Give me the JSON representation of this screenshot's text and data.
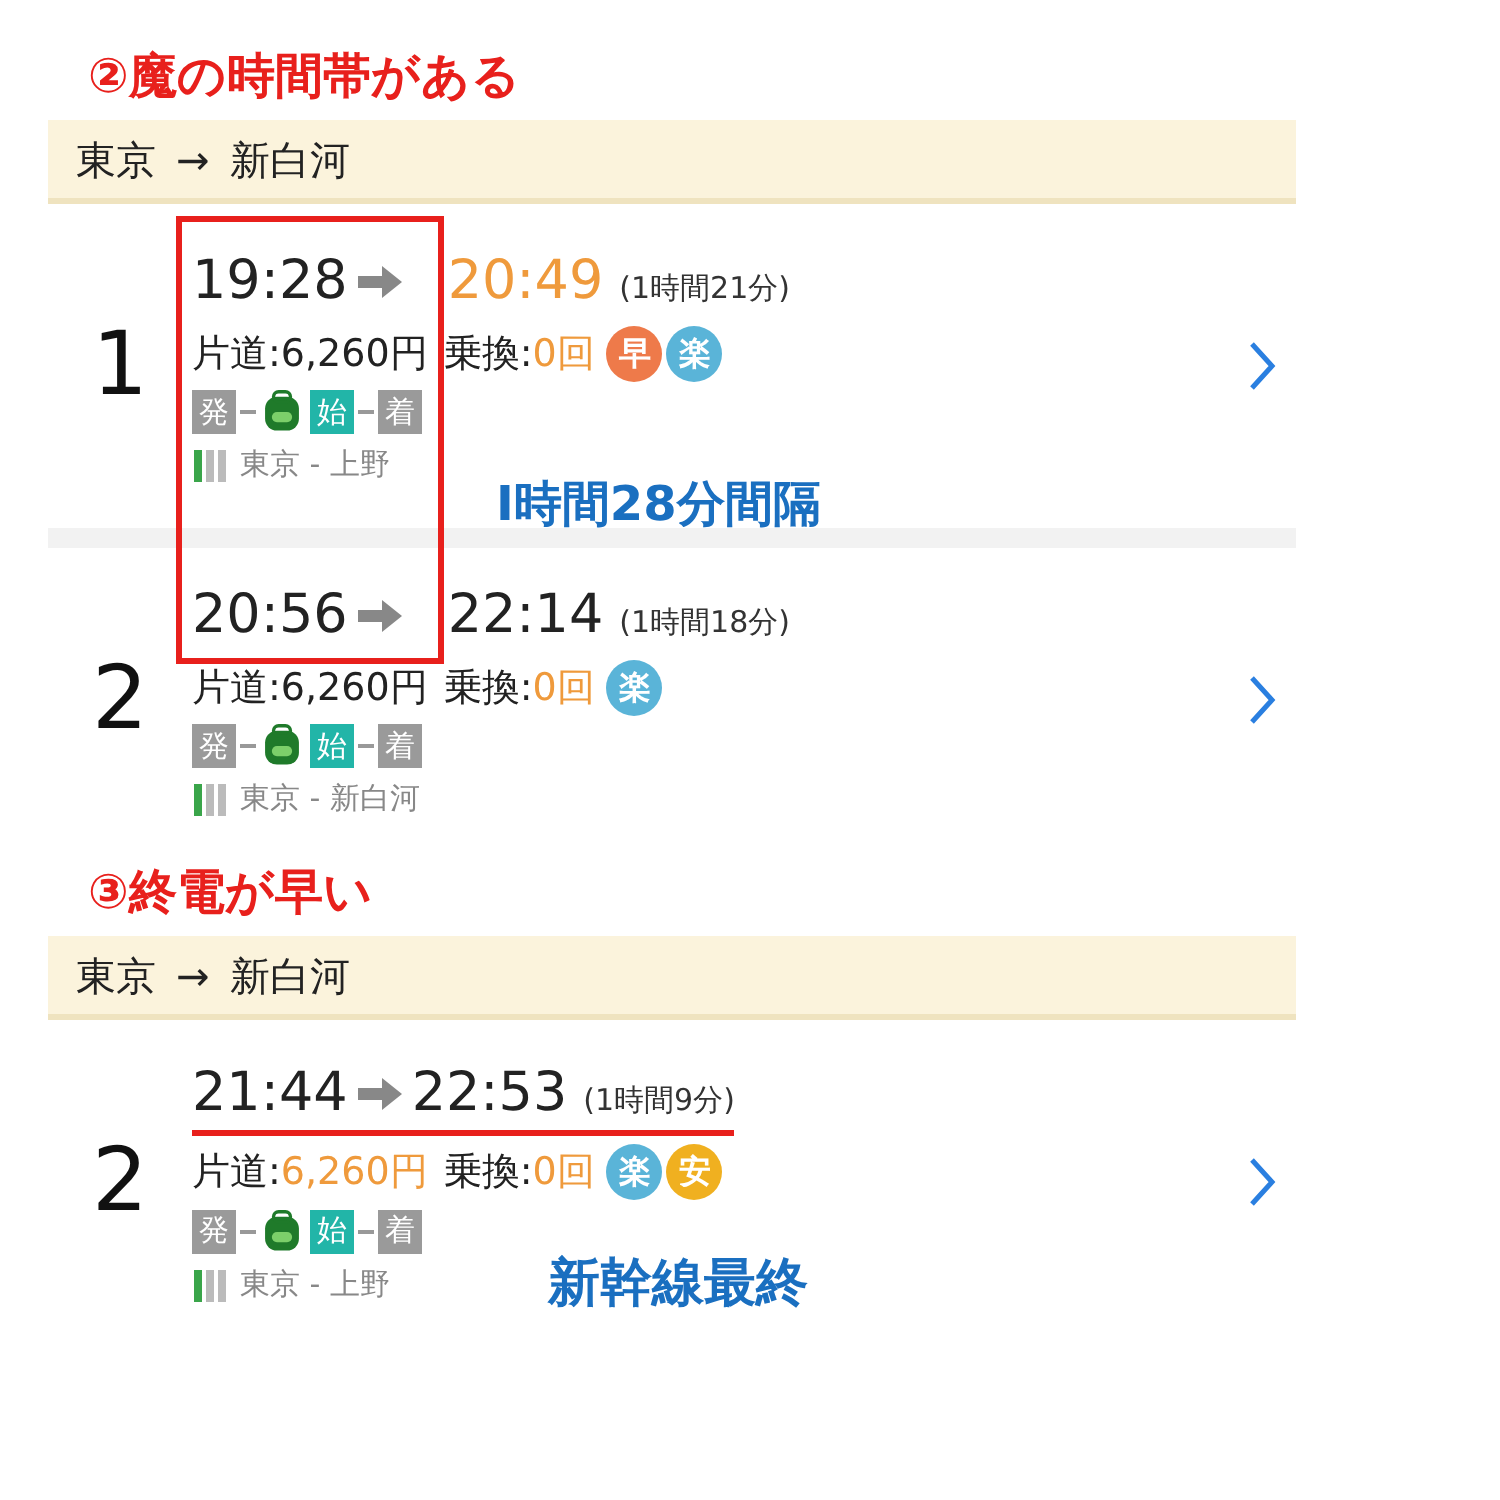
{
  "sections": [
    {
      "title": "②魔の時間帯がある",
      "header": {
        "from": "東京",
        "arrow": "→",
        "to": "新白河"
      },
      "kind": "box",
      "note": "I時間28分間隔",
      "routes": [
        {
          "number": "1",
          "depart": "19:28",
          "arrive": "20:49",
          "arrive_highlighted": true,
          "duration": "(1時間21分)",
          "fare_label": "片道:",
          "fare": "6,260円",
          "fare_highlighted": false,
          "transfer_label": "乗換:",
          "transfers": "0回",
          "badges": [
            {
              "text": "早",
              "color": "#ee7a4a"
            },
            {
              "text": "楽",
              "color": "#5ab4d8"
            }
          ],
          "stops": [
            {
              "text": "発",
              "color": "#9a9a9a"
            },
            {
              "text": "始",
              "color": "#22b5a8"
            },
            {
              "text": "着",
              "color": "#9a9a9a"
            }
          ],
          "segment": "東京 - 上野"
        },
        {
          "number": "2",
          "depart": "20:56",
          "arrive": "22:14",
          "arrive_highlighted": false,
          "duration": "(1時間18分)",
          "fare_label": "片道:",
          "fare": "6,260円",
          "fare_highlighted": false,
          "transfer_label": "乗換:",
          "transfers": "0回",
          "badges": [
            {
              "text": "楽",
              "color": "#5ab4d8"
            }
          ],
          "stops": [
            {
              "text": "発",
              "color": "#9a9a9a"
            },
            {
              "text": "始",
              "color": "#22b5a8"
            },
            {
              "text": "着",
              "color": "#9a9a9a"
            }
          ],
          "segment": "東京 - 新白河"
        }
      ]
    },
    {
      "title": "③終電が早い",
      "header": {
        "from": "東京",
        "arrow": "→",
        "to": "新白河"
      },
      "kind": "underline",
      "note": "新幹線最終",
      "routes": [
        {
          "number": "2",
          "depart": "21:44",
          "arrive": "22:53",
          "arrive_highlighted": false,
          "duration": "(1時間9分)",
          "fare_label": "片道:",
          "fare": "6,260円",
          "fare_highlighted": true,
          "transfer_label": "乗換:",
          "transfers": "0回",
          "badges": [
            {
              "text": "楽",
              "color": "#5ab4d8"
            },
            {
              "text": "安",
              "color": "#f0b020"
            }
          ],
          "stops": [
            {
              "text": "発",
              "color": "#9a9a9a"
            },
            {
              "text": "始",
              "color": "#22b5a8"
            },
            {
              "text": "着",
              "color": "#9a9a9a"
            }
          ],
          "segment": "東京 - 上野"
        }
      ]
    }
  ]
}
